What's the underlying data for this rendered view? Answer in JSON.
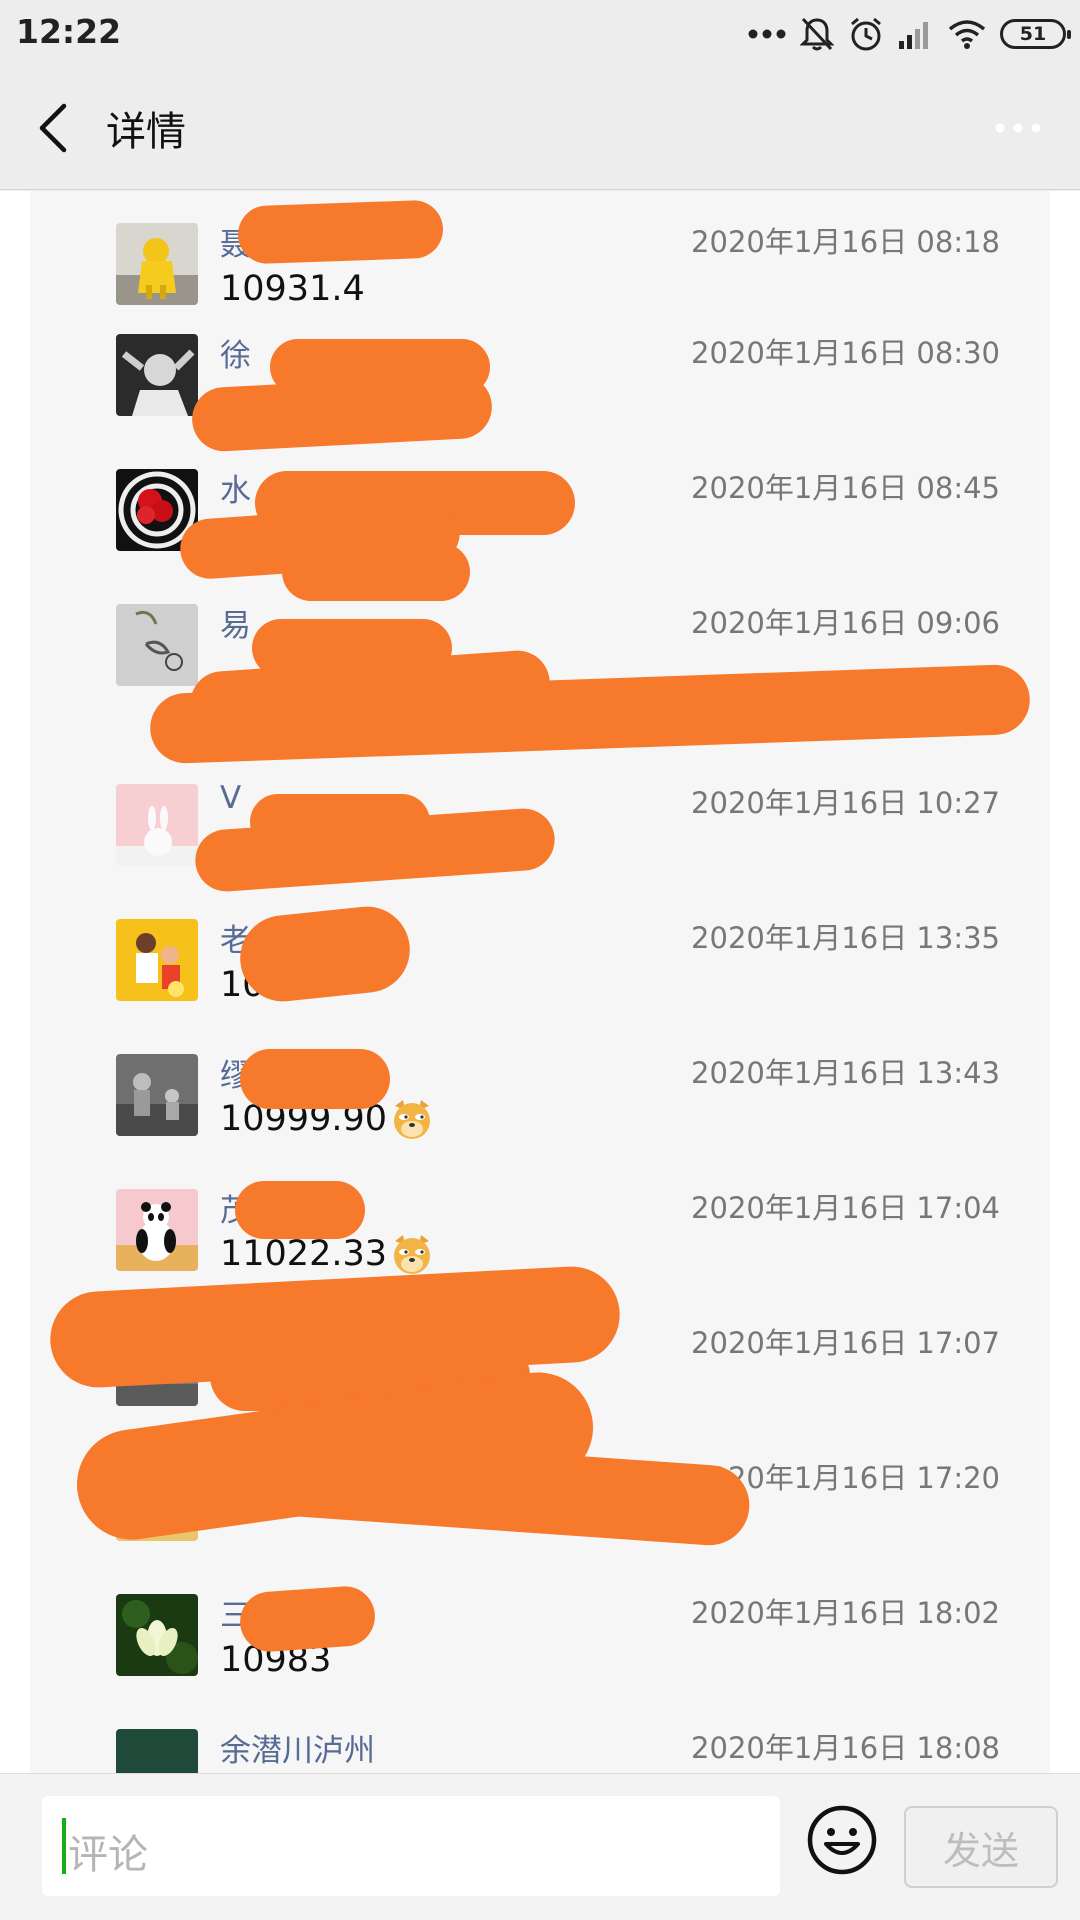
{
  "status_bar": {
    "time": "12:22",
    "battery": "51"
  },
  "nav": {
    "title": "详情"
  },
  "colors": {
    "accent": "#576b95",
    "redaction": "#f7792b",
    "caret": "#1aad19"
  },
  "comments": [
    {
      "name": "聂",
      "time": "2020年1月16日 08:18",
      "text": "10931.4",
      "avatar": "yellow-figure"
    },
    {
      "name": "徐",
      "time": "2020年1月16日 08:30",
      "text": "",
      "avatar": "bw-portrait"
    },
    {
      "name": "水",
      "time": "2020年1月16日 08:45",
      "text": "",
      "avatar": "red-flower-target"
    },
    {
      "name": "易",
      "time": "2020年1月16日 09:06",
      "text": "",
      "avatar": "calligraphy"
    },
    {
      "name": "V",
      "time": "2020年1月16日 10:27",
      "text": "",
      "avatar": "pink-rabbit"
    },
    {
      "name": "老",
      "time": "2020年1月16日 13:35",
      "text": "10985",
      "avatar": "yellow-family"
    },
    {
      "name": "缪",
      "time": "2020年1月16日 13:43",
      "text": "10999.90",
      "emoji": "doge",
      "avatar": "bw-children"
    },
    {
      "name": "茂",
      "time": "2020年1月16日 17:04",
      "text": "11022.33",
      "emoji": "doge",
      "avatar": "panda"
    },
    {
      "name": "",
      "time": "2020年1月16日 17:07",
      "text": "",
      "avatar": "grey-photo"
    },
    {
      "name": "",
      "time": "2020年1月16日 17:20",
      "text": "",
      "avatar": "redacted"
    },
    {
      "name": "三",
      "time": "2020年1月16日 18:02",
      "text": "10983",
      "avatar": "lotus"
    },
    {
      "name": "余潜川泸州",
      "time": "2020年1月16日 18:08",
      "text": "",
      "avatar": "green-dark"
    }
  ],
  "input": {
    "placeholder": "评论"
  },
  "send_button": {
    "label": "发送"
  }
}
